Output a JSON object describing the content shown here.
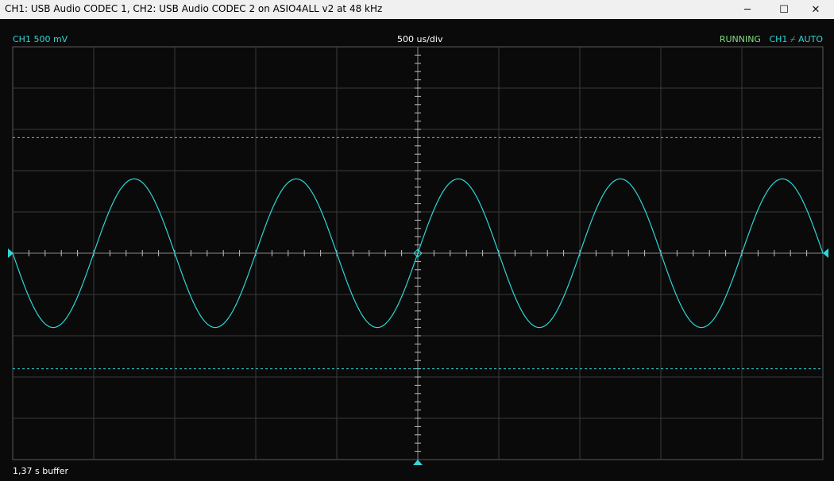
{
  "window": {
    "title": "CH1: USB Audio CODEC  1, CH2: USB Audio CODEC  2 on ASIO4ALL v2 at 48 kHz",
    "minimize_glyph": "─",
    "maximize_glyph": "☐",
    "close_glyph": "✕"
  },
  "scope": {
    "channel_scale": "CH1 500 mV",
    "timebase": "500 us/div",
    "status": "RUNNING",
    "trigger_channel": "CH1",
    "trigger_slope_glyph": "⌿",
    "trigger_mode": "AUTO",
    "buffer": "1,37 s buffer",
    "colors": {
      "background": "#0a0a0a",
      "grid": "#3a3a3a",
      "trace": "#2fd6d6",
      "status": "#7ee07e",
      "label": "#2fd6d6",
      "trigger_marker": "#2fd6d6"
    },
    "icons": {
      "left_marker": "ground-level-marker-icon",
      "right_marker": "trigger-level-marker-icon",
      "bottom_marker": "trigger-position-marker-icon"
    }
  },
  "chart_data": {
    "type": "line",
    "x_divisions": 10,
    "y_divisions": 10,
    "xlim": [
      -2.5,
      2.5
    ],
    "ylim": [
      -2.5,
      2.5
    ],
    "cursor_levels": [
      1.4,
      -1.4
    ],
    "series": [
      {
        "amplitude": 0.9,
        "period": 1.0,
        "phase": 0.0
      }
    ]
  }
}
